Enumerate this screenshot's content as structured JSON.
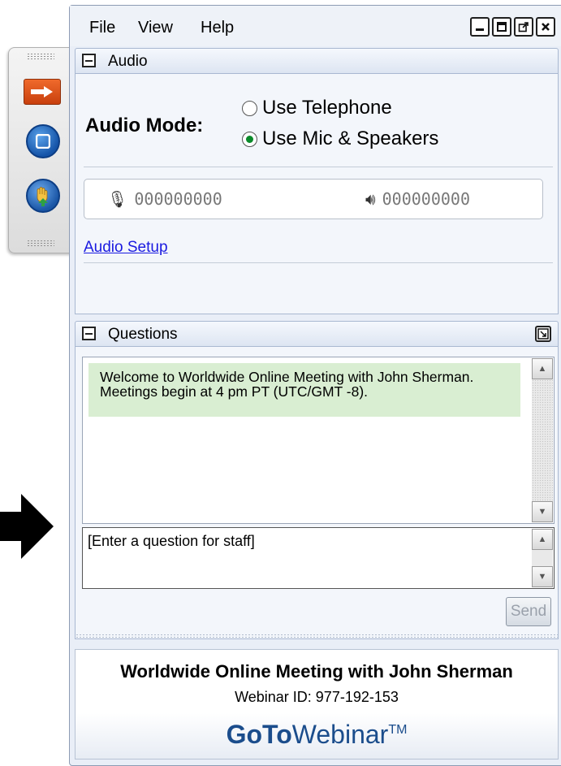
{
  "menu": {
    "file": "File",
    "view": "View",
    "help": "Help"
  },
  "audio": {
    "header": "Audio",
    "mode_label": "Audio Mode:",
    "options": [
      "Use Telephone",
      "Use Mic & Speakers"
    ],
    "selected": "Use Mic & Speakers",
    "mic_level": "000000000",
    "speaker_level": "000000000",
    "setup_link": "Audio Setup"
  },
  "questions": {
    "header": "Questions",
    "welcome": "Welcome to Worldwide Online Meeting with John Sherman.  Meetings begin at 4 pm PT (UTC/GMT -8).",
    "input_placeholder": "[Enter a question for staff]",
    "send_label": "Send"
  },
  "footer": {
    "meeting_title": "Worldwide Online Meeting with John Sherman",
    "webinar_id": "Webinar ID: 977-192-153",
    "brand_goto": "GoTo",
    "brand_webinar": "Webinar",
    "brand_tm": "TM"
  },
  "colors": {
    "accent": "#1b4d8c",
    "welcome_bg": "#d9eed2",
    "grab_orange": "#e3581f"
  }
}
